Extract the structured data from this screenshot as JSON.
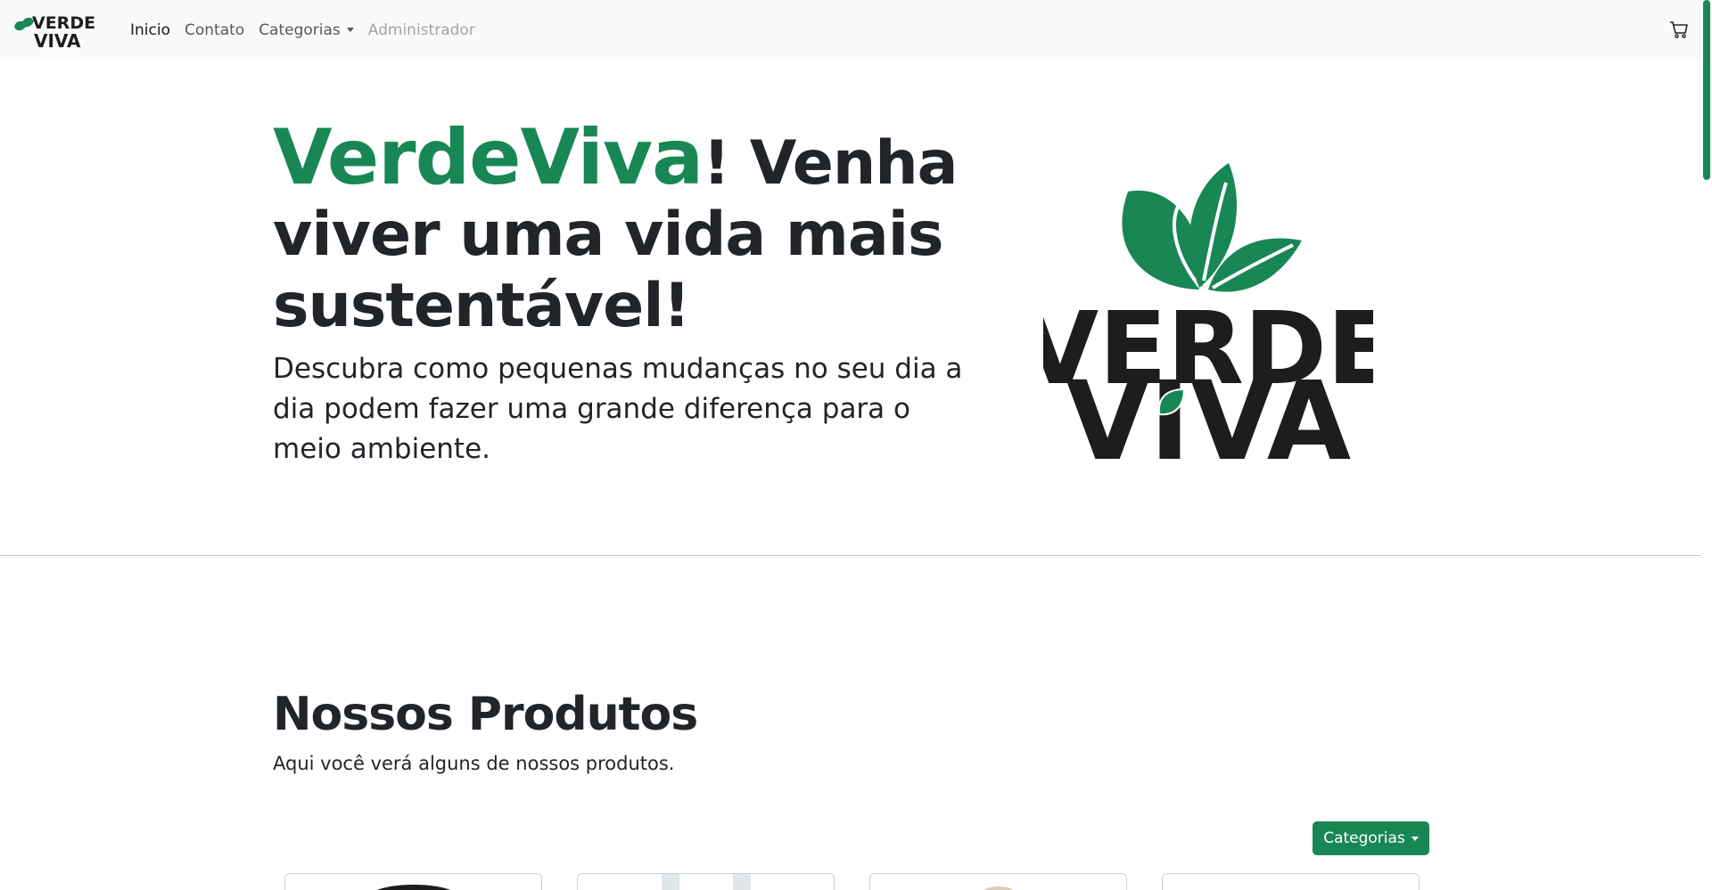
{
  "brand": {
    "line1": "VERDE",
    "line2": "VIVA"
  },
  "nav": {
    "items": [
      {
        "label": "Inicio",
        "state": "active"
      },
      {
        "label": "Contato",
        "state": "normal"
      },
      {
        "label": "Categorias",
        "state": "dropdown"
      },
      {
        "label": "Administrador",
        "state": "disabled"
      }
    ],
    "cart_icon": "cart-icon"
  },
  "hero": {
    "title_highlight": "VerdeViva",
    "title_rest": "! Venha viver uma vida mais sustentável!",
    "subtitle": "Descubra como pequenas mudanças no seu dia a dia podem fazer uma grande diferença para o meio ambiente.",
    "logo_line1": "VERDE",
    "logo_line2": "VIVA"
  },
  "products": {
    "title": "Nossos Produtos",
    "subtitle": "Aqui você verá alguns de nossos produtos.",
    "category_button": "Categorias"
  },
  "colors": {
    "accent": "#198754",
    "text": "#212529",
    "navbar_bg": "#f8f9fa",
    "logo_dark": "#1d1d1d"
  }
}
